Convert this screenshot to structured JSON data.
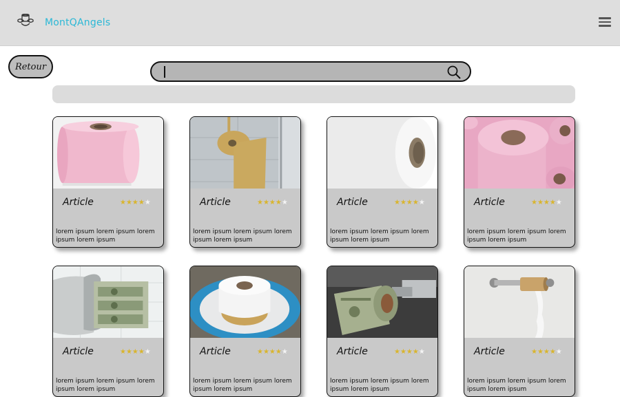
{
  "header": {
    "brand": "MontQAngels",
    "logo_icon": "angel-logo-icon",
    "menu_icon": "hamburger-menu-icon",
    "brand_color": "#2bb8d6"
  },
  "back_button": {
    "label": "Retour"
  },
  "search": {
    "value": "",
    "placeholder": "",
    "icon": "search-icon"
  },
  "products": [
    {
      "title": "Article",
      "rating": 4,
      "max_rating": 5,
      "description": "lorem ipsum lorem ipsum lorem ipsum lorem ipsum",
      "image": "pink-toilet-roll"
    },
    {
      "title": "Article",
      "rating": 4,
      "max_rating": 5,
      "description": "lorem ipsum lorem ipsum lorem ipsum lorem ipsum",
      "image": "gold-toilet-paper-holder"
    },
    {
      "title": "Article",
      "rating": 4,
      "max_rating": 5,
      "description": "lorem ipsum lorem ipsum lorem ipsum lorem ipsum",
      "image": "white-toilet-roll"
    },
    {
      "title": "Article",
      "rating": 4,
      "max_rating": 5,
      "description": "lorem ipsum lorem ipsum lorem ipsum lorem ipsum",
      "image": "pink-toilet-rolls-stack"
    },
    {
      "title": "Article",
      "rating": 4,
      "max_rating": 5,
      "description": "lorem ipsum lorem ipsum lorem ipsum lorem ipsum",
      "image": "dollar-roll-dispenser"
    },
    {
      "title": "Article",
      "rating": 4,
      "max_rating": 5,
      "description": "lorem ipsum lorem ipsum lorem ipsum lorem ipsum",
      "image": "roll-on-plate"
    },
    {
      "title": "Article",
      "rating": 4,
      "max_rating": 5,
      "description": "lorem ipsum lorem ipsum lorem ipsum lorem ipsum",
      "image": "dollar-roll-holder"
    },
    {
      "title": "Article",
      "rating": 4,
      "max_rating": 5,
      "description": "lorem ipsum lorem ipsum lorem ipsum lorem ipsum",
      "image": "empty-roll-holder"
    }
  ]
}
